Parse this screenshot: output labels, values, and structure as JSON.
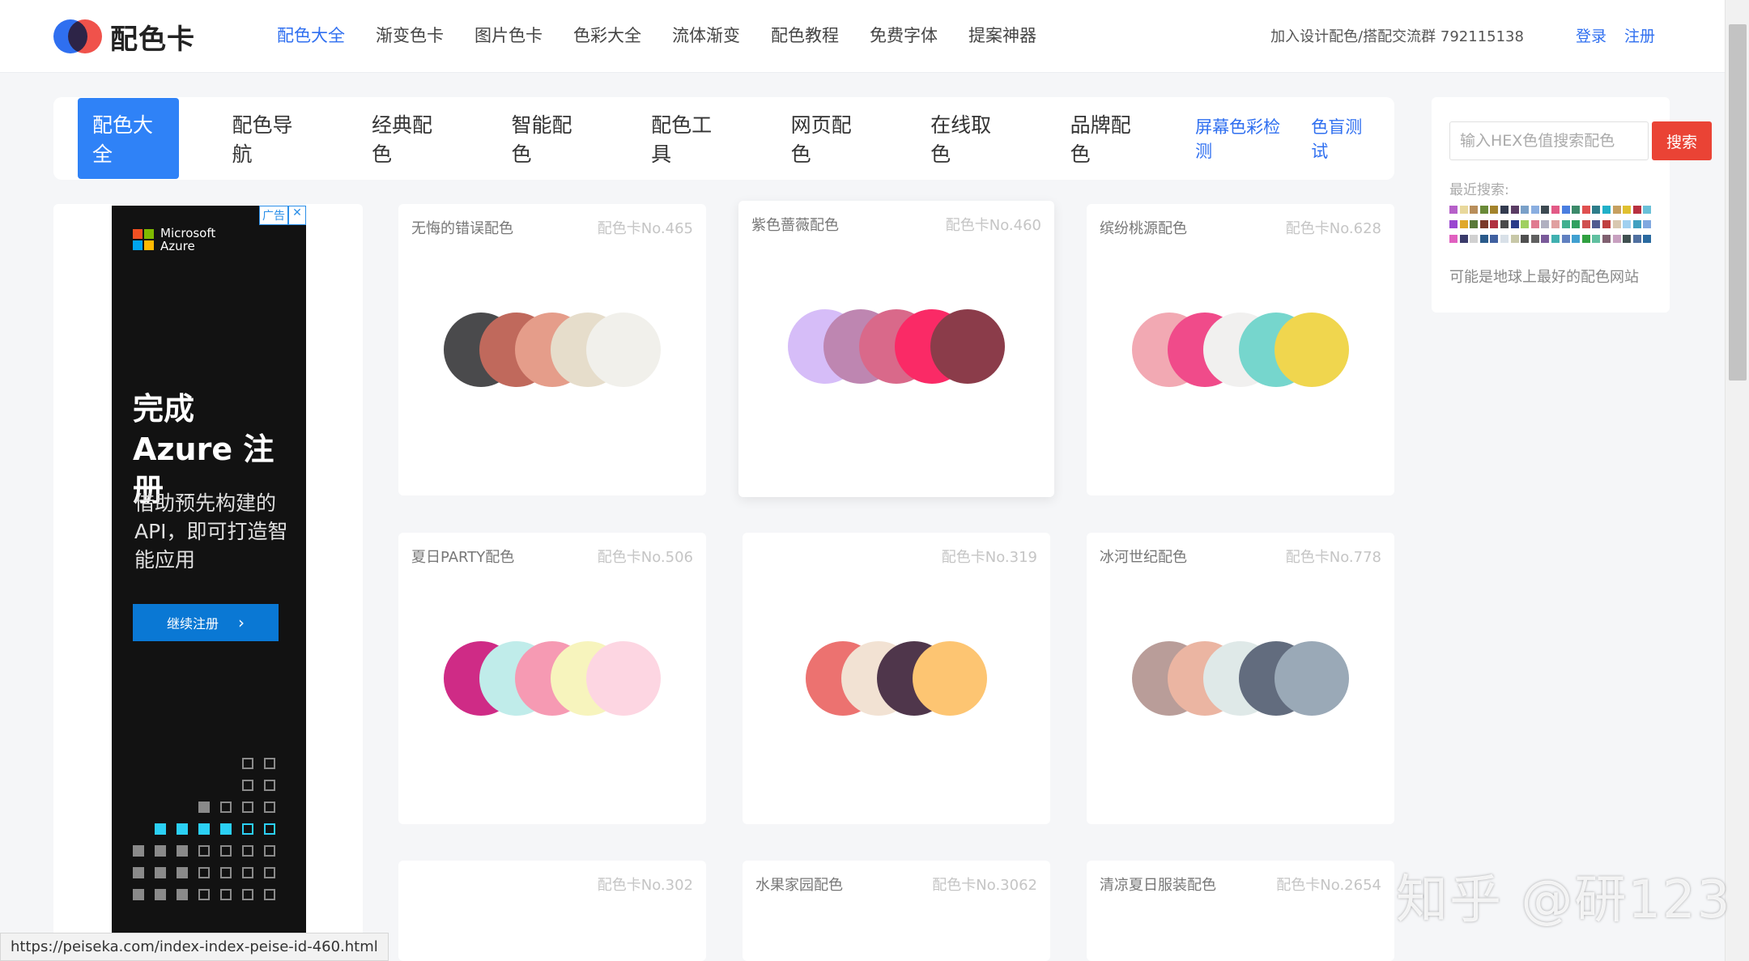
{
  "header": {
    "logo_text": "配色卡",
    "nav": [
      {
        "label": "配色大全",
        "active": true
      },
      {
        "label": "渐变色卡"
      },
      {
        "label": "图片色卡"
      },
      {
        "label": "色彩大全"
      },
      {
        "label": "流体渐变"
      },
      {
        "label": "配色教程"
      },
      {
        "label": "免费字体"
      },
      {
        "label": "提案神器"
      }
    ],
    "group_text": "加入设计配色/搭配交流群 792115138",
    "login": "登录",
    "register": "注册"
  },
  "subnav": {
    "tabs": [
      {
        "label": "配色大全",
        "active": true
      },
      {
        "label": "配色导航"
      },
      {
        "label": "经典配色"
      },
      {
        "label": "智能配色"
      },
      {
        "label": "配色工具"
      },
      {
        "label": "网页配色"
      },
      {
        "label": "在线取色"
      },
      {
        "label": "品牌配色"
      }
    ],
    "links": [
      "屏幕色彩检测",
      "色盲测试"
    ]
  },
  "ad": {
    "tag": "广告",
    "close": "✕",
    "brand_line1": "Microsoft",
    "brand_line2": "Azure",
    "headline": "完成 Azure 注册",
    "body": "借助预先构建的 API，即可打造智能应用",
    "button": "继续注册",
    "button_chevron": "›",
    "ms_colors": [
      "#f25022",
      "#7fba00",
      "#00a4ef",
      "#ffb900"
    ]
  },
  "cards": [
    {
      "name": "无悔的错误配色",
      "num": "配色卡No.465",
      "colors": [
        "#4a4a4c",
        "#c0695c",
        "#e59d8a",
        "#e6ddcb",
        "#f1f0eb"
      ]
    },
    {
      "name": "紫色蔷薇配色",
      "num": "配色卡No.460",
      "colors": [
        "#d6bdf8",
        "#be86b1",
        "#d9698a",
        "#fa2a66",
        "#8b3c4a"
      ]
    },
    {
      "name": "缤纷桃源配色",
      "num": "配色卡No.628",
      "colors": [
        "#f2a9b3",
        "#f04b8a",
        "#f1f0ef",
        "#76d6cd",
        "#f0d64e"
      ]
    },
    {
      "name": "夏日PARTY配色",
      "num": "配色卡No.506",
      "colors": [
        "#cf2b86",
        "#c0ecea",
        "#f69ab3",
        "#f7f4bd",
        "#fdd6e2"
      ]
    },
    {
      "name": "",
      "num": "配色卡No.319",
      "colors": [
        "#ec7270",
        "#f2e2d3",
        "#4f364b",
        "#fdc572"
      ]
    },
    {
      "name": "冰河世纪配色",
      "num": "配色卡No.778",
      "colors": [
        "#b99d99",
        "#ebb5a2",
        "#dfe9e8",
        "#626c7e",
        "#9aa9b7"
      ]
    },
    {
      "name": "",
      "num": "配色卡No.302",
      "colors": []
    },
    {
      "name": "水果家园配色",
      "num": "配色卡No.3062",
      "colors": []
    },
    {
      "name": "清凉夏日服装配色",
      "num": "配色卡No.2654",
      "colors": []
    }
  ],
  "sidebar": {
    "search_placeholder": "输入HEX色值搜索配色",
    "search_button": "搜索",
    "recent_label": "最近搜索:",
    "recent_swatches": [
      "#b660c9",
      "#e8d89c",
      "#b88e5b",
      "#6a8a38",
      "#a3832c",
      "#333b4f",
      "#5a3c64",
      "#7aa0c8",
      "#8aaee0",
      "#3d4a52",
      "#e25a86",
      "#4a7ee0",
      "#3c8a6a",
      "#e05050",
      "#2e7d8a",
      "#20b0c8",
      "#c6a060",
      "#e0c030",
      "#b83040",
      "#6ac0d8",
      "#9a46d0",
      "#e0a82a",
      "#5a7a3a",
      "#7a3a2a",
      "#b03040",
      "#4a4a4a",
      "#2a3a8a",
      "#a0d060",
      "#e07a90",
      "#b0b0c0",
      "#e0a0a0",
      "#40b090",
      "#30a060",
      "#d05050",
      "#505a90",
      "#c04040",
      "#d8c8b0",
      "#a0d0f0",
      "#40a0c0",
      "#80a8e0",
      "#e060c0",
      "#3a3a6a",
      "#d0d0d0",
      "#2a5a8a",
      "#4060a0",
      "#d8e0e8",
      "#c8c8a8",
      "#505050",
      "#606060",
      "#7a5a9a",
      "#40b0b0",
      "#6080c0",
      "#40a0d0",
      "#30a040",
      "#60c0a0",
      "#806070",
      "#c8a0c0",
      "#405050",
      "#5070a0",
      "#2a6aa0"
    ],
    "tagline": "可能是地球上最好的配色网站"
  },
  "statusbar": "https://peiseka.com/index-index-peise-id-460.html",
  "watermark": "知乎 @研123"
}
